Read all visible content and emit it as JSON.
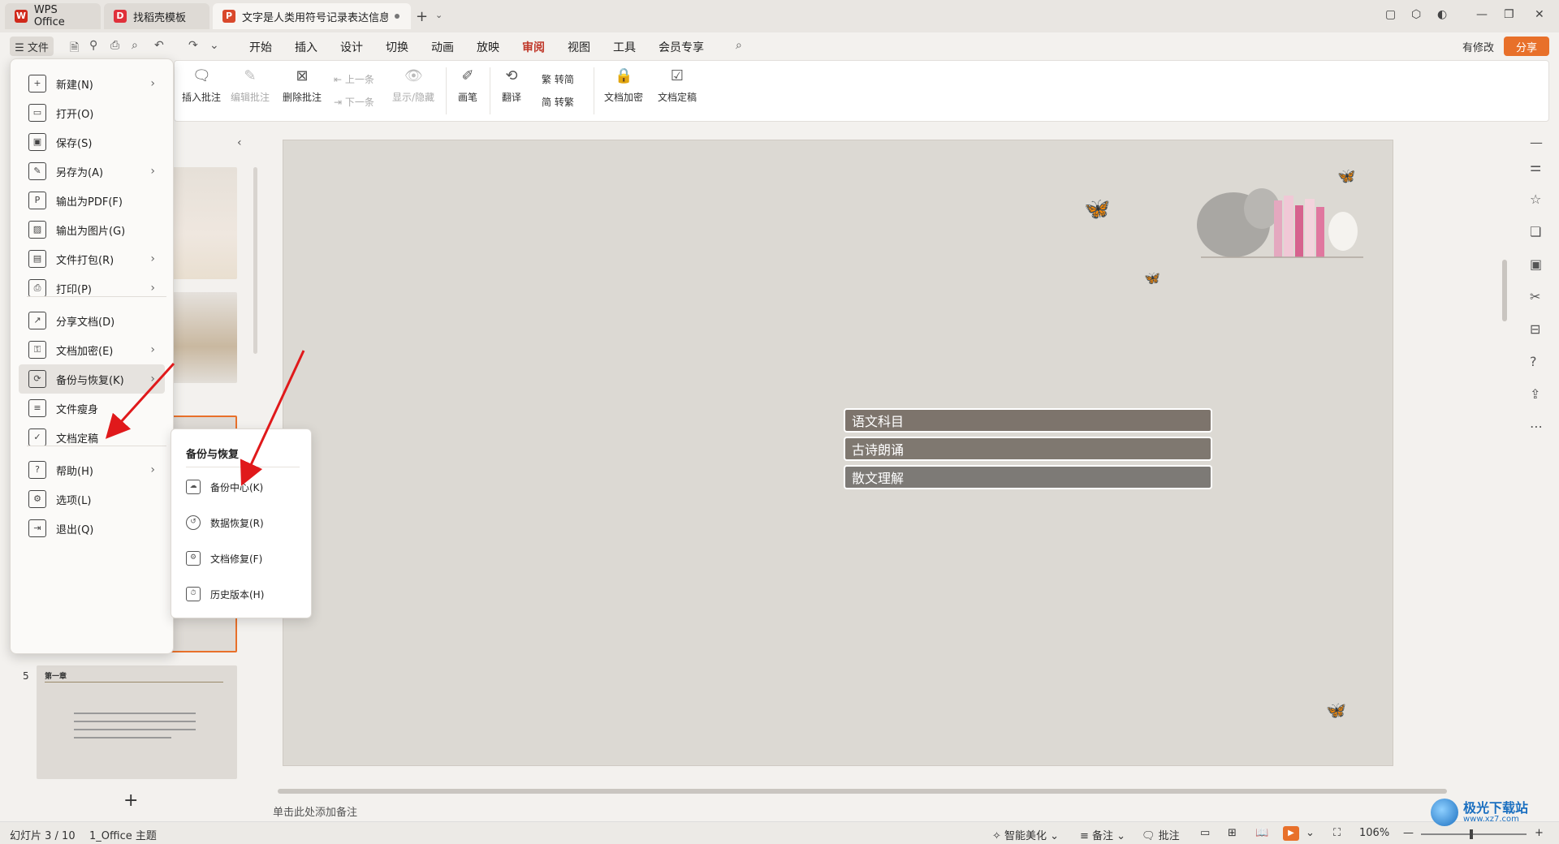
{
  "titlebar": {
    "tabs": [
      {
        "label": "WPS Office",
        "icon": "wps-logo-icon"
      },
      {
        "label": "找稻壳模板",
        "icon": "docer-icon"
      },
      {
        "label": "文字是人类用符号记录表达信息以",
        "icon": "ppt-icon"
      }
    ],
    "new_tab": "+",
    "accent": "#c0392b"
  },
  "menubar": {
    "file_label": "☰ 文件",
    "items": [
      "开始",
      "插入",
      "设计",
      "切换",
      "动画",
      "放映",
      "审阅",
      "视图",
      "工具",
      "会员专享"
    ],
    "active": "审阅",
    "has_changes": "有修改",
    "share": "分享"
  },
  "ribbon": {
    "insert_comment": "插入批注",
    "edit_comment": "编辑批注",
    "delete_comment": "删除批注",
    "prev": "上一条",
    "next": "下一条",
    "show_hide": "显示/隐藏",
    "pen": "画笔",
    "translate": "翻译",
    "to_simplified": "转简",
    "to_traditional": "转繁",
    "encrypt": "文档加密",
    "finalize": "文档定稿"
  },
  "file_menu": {
    "items": [
      {
        "label": "新建(N)",
        "icon": "new-file-icon",
        "arrow": true
      },
      {
        "label": "打开(O)",
        "icon": "open-folder-icon",
        "arrow": false
      },
      {
        "label": "保存(S)",
        "icon": "save-icon",
        "arrow": false
      },
      {
        "label": "另存为(A)",
        "icon": "save-as-icon",
        "arrow": true
      },
      {
        "label": "输出为PDF(F)",
        "icon": "pdf-icon",
        "arrow": false
      },
      {
        "label": "输出为图片(G)",
        "icon": "image-icon",
        "arrow": false
      },
      {
        "label": "文件打包(R)",
        "icon": "package-icon",
        "arrow": true
      },
      {
        "label": "打印(P)",
        "icon": "print-icon",
        "arrow": true
      },
      {
        "label": "分享文档(D)",
        "icon": "share-icon",
        "arrow": false
      },
      {
        "label": "文档加密(E)",
        "icon": "lock-file-icon",
        "arrow": true
      },
      {
        "label": "备份与恢复(K)",
        "icon": "backup-icon",
        "arrow": true
      },
      {
        "label": "文件瘦身",
        "icon": "slim-icon",
        "arrow": false
      },
      {
        "label": "文档定稿",
        "icon": "finalize-icon",
        "arrow": false
      },
      {
        "label": "帮助(H)",
        "icon": "help-icon",
        "arrow": true
      },
      {
        "label": "选项(L)",
        "icon": "gear-icon",
        "arrow": false
      },
      {
        "label": "退出(Q)",
        "icon": "exit-icon",
        "arrow": false
      }
    ]
  },
  "submenu": {
    "title": "备份与恢复",
    "items": [
      {
        "label": "备份中心(K)",
        "icon": "backup-center-icon"
      },
      {
        "label": "数据恢复(R)",
        "icon": "restore-icon"
      },
      {
        "label": "文档修复(F)",
        "icon": "repair-icon"
      },
      {
        "label": "历史版本(H)",
        "icon": "history-icon"
      }
    ]
  },
  "slide": {
    "bars": [
      {
        "text": "语文科目",
        "color": "#7d746c"
      },
      {
        "text": "古诗朗诵",
        "color": "#7f7870"
      },
      {
        "text": "散文理解",
        "color": "#7d7a76"
      }
    ]
  },
  "thumbs": {
    "slide5_num": "5",
    "slide5_title": "第一章",
    "add": "+"
  },
  "notes_placeholder": "单击此处添加备注",
  "status": {
    "slide_info": "幻灯片 3 / 10",
    "theme": "1_Office 主题",
    "beautify": "智能美化",
    "notes": "备注",
    "comments": "批注",
    "zoom": "106%"
  },
  "watermark": {
    "title": "极光下载站",
    "url": "www.xz7.com"
  }
}
